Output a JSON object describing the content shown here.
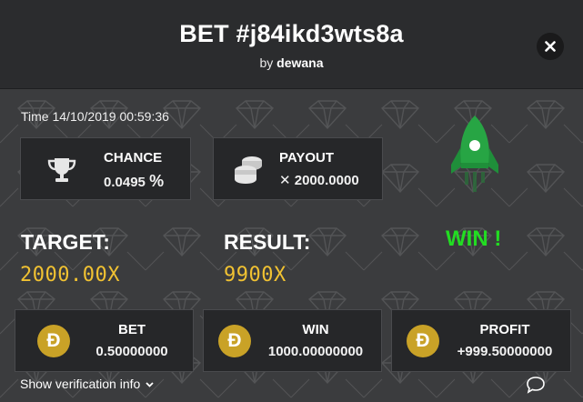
{
  "header": {
    "title": "BET #j84ikd3wts8a",
    "by_prefix": "by",
    "username": "dewana",
    "close_icon": "close-icon"
  },
  "time_label": "Time 14/10/2019 00:59:36",
  "chance": {
    "label": "CHANCE",
    "value": "0.0495",
    "unit": "%",
    "icon": "trophy-icon"
  },
  "payout": {
    "label": "PAYOUT",
    "prefix": "✕",
    "value": "2000.0000",
    "icon": "coins-stack-icon"
  },
  "target": {
    "label": "TARGET:",
    "value": "2000.00X"
  },
  "result": {
    "label": "RESULT:",
    "value": "9900X"
  },
  "outcome": {
    "text": "WIN !",
    "icon": "rocket-icon",
    "color": "#22dd22"
  },
  "bottom": [
    {
      "label": "BET",
      "value": "0.50000000",
      "icon": "doge-coin-icon",
      "symbol": "Đ"
    },
    {
      "label": "WIN",
      "value": "1000.00000000",
      "icon": "doge-coin-icon",
      "symbol": "Đ"
    },
    {
      "label": "PROFIT",
      "value": "+999.50000000",
      "icon": "doge-coin-icon",
      "symbol": "Đ"
    }
  ],
  "footer": {
    "verify_label": "Show verification info",
    "chat_icon": "chat-bubble-icon"
  },
  "colors": {
    "accent_yellow": "#f1c232",
    "win_green": "#22dd22",
    "coin_gold": "#c9a227"
  }
}
